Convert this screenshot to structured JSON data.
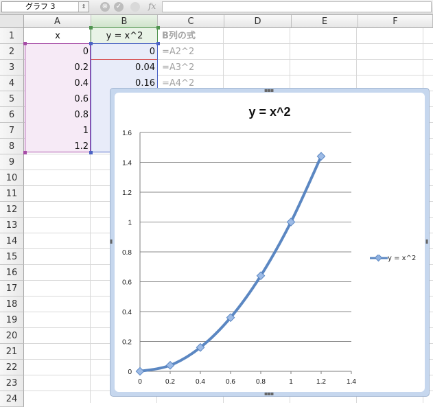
{
  "formula_bar": {
    "name_box": "グラフ 3",
    "name_box_arrow": "⇕",
    "cancel_icon": "⊗",
    "confirm_icon": "✓",
    "fx_icon": "fx",
    "formula": ""
  },
  "columns": [
    "A",
    "B",
    "C",
    "D",
    "E",
    "F"
  ],
  "rows": [
    "1",
    "2",
    "3",
    "4",
    "5",
    "6",
    "7",
    "8",
    "9",
    "10",
    "11",
    "12",
    "13",
    "14",
    "15",
    "16",
    "17",
    "18",
    "19",
    "20",
    "21",
    "22",
    "23",
    "24"
  ],
  "cells": {
    "A1": "x",
    "B1": "y = x^2",
    "C1": "B列の式",
    "A": [
      "0",
      "0.2",
      "0.4",
      "0.6",
      "0.8",
      "1",
      "1.2"
    ],
    "B": [
      "0",
      "0.04",
      "0.16"
    ],
    "C": [
      "=A2^2",
      "=A3^2",
      "=A4^2"
    ]
  },
  "colors": {
    "series": "#5b87c2",
    "selection_a": "#a64ca6",
    "selection_b": "#4b63c4",
    "chart_frame": "#c6d7ee"
  },
  "chart_data": {
    "type": "line",
    "title": "y = x^2",
    "x": [
      0,
      0.2,
      0.4,
      0.6,
      0.8,
      1,
      1.2
    ],
    "series": [
      {
        "name": "y = x^2",
        "values": [
          0,
          0.04,
          0.16,
          0.36,
          0.64,
          1,
          1.44
        ]
      }
    ],
    "xlim": [
      0,
      1.4
    ],
    "ylim": [
      0,
      1.6
    ],
    "xticks": [
      "0",
      "0.2",
      "0.4",
      "0.6",
      "0.8",
      "1",
      "1.2",
      "1.4"
    ],
    "yticks": [
      "0",
      "0.2",
      "0.4",
      "0.6",
      "0.8",
      "1",
      "1.2",
      "1.4",
      "1.6"
    ],
    "grid": "horizontal",
    "legend": "right",
    "marker": "diamond",
    "smooth": true
  }
}
